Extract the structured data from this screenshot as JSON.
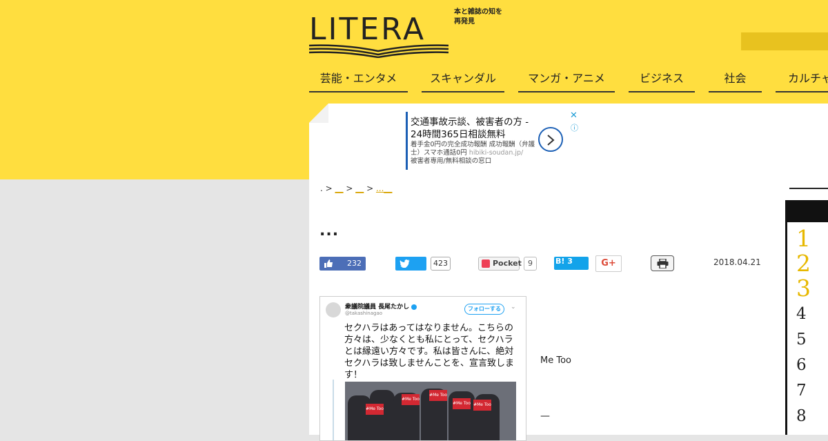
{
  "brand": {
    "logo_text": "LITERA",
    "tagline": "本と雑誌の知を再発見"
  },
  "nav": {
    "items": [
      "芸能・エンタメ",
      "スキャンダル",
      "マンガ・アニメ",
      "ビジネス",
      "社会",
      "カルチャ"
    ]
  },
  "ad": {
    "title": "交通事故示談、被害者の方 - 24時間365日相談無料",
    "desc": "着手金0円の完全成功報酬 成功報酬（弁護士）スマホ通話0円",
    "url": "hibiki-soudan.jp/",
    "desc2": "被害者専用/無料相談の窓口",
    "close": "✕",
    "info": "ⓘ"
  },
  "breadcrumb": {
    "home": ".",
    "sep": ">",
    "c1": "__",
    "c2": "__",
    "c3": "...__"
  },
  "article": {
    "title": "...",
    "date": "2018.04.21",
    "body_text": "Me Too",
    "dash": "—"
  },
  "share": {
    "facebook_count": "232",
    "twitter_count": "423",
    "pocket_label": "Pocket",
    "pocket_count": "9",
    "hatena_label": "B! 3",
    "gplus_label": "G+"
  },
  "tweet": {
    "name": "衆議院議員 長尾たかし",
    "handle": "@takashinagao",
    "follow": "フォローする",
    "chevron": "⌄",
    "text": "セクハラはあってはなりません。こちらの方々は、少なくとも私にとって、セクハラとは縁遠い方々です。私は皆さんに、絶対セクハラは致しませんことを、宣言致します！",
    "sign_text": "#Me Too"
  },
  "ranking": {
    "numbers": [
      "1",
      "2",
      "3",
      "4",
      "5",
      "6",
      "7",
      "8"
    ]
  },
  "colors": {
    "brand_yellow": "#ffde3f",
    "accent_gold": "#e7b800",
    "facebook": "#4c6eb7",
    "twitter": "#1da1f2",
    "hatena": "#13a3ea"
  }
}
